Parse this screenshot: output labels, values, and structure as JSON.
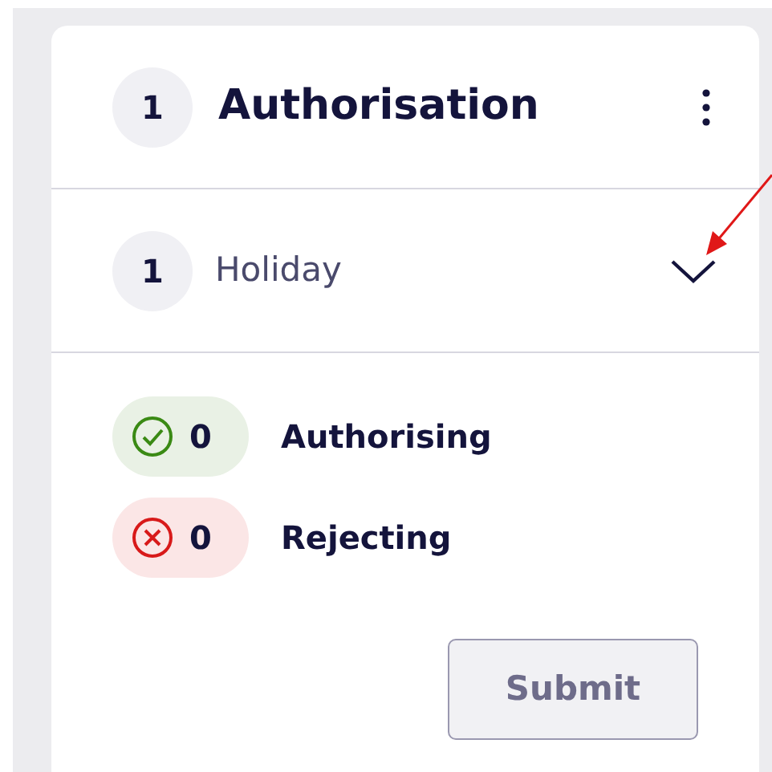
{
  "header": {
    "count": "1",
    "title": "Authorisation"
  },
  "group": {
    "count": "1",
    "label": "Holiday",
    "expanded": false
  },
  "tallies": [
    {
      "kind": "authorise",
      "count": "0",
      "label": "Authorising"
    },
    {
      "kind": "reject",
      "count": "0",
      "label": "Rejecting"
    }
  ],
  "submit": {
    "label": "Submit",
    "disabled": true
  }
}
